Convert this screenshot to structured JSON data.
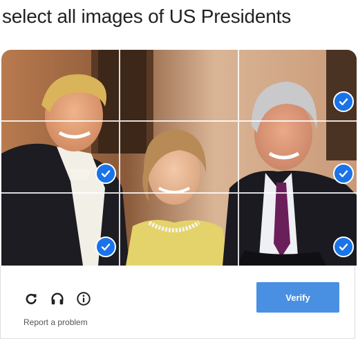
{
  "prompt": "select all images of US Presidents",
  "grid": {
    "tiles": [
      {
        "selected": false
      },
      {
        "selected": false
      },
      {
        "selected": true
      },
      {
        "selected": true
      },
      {
        "selected": false
      },
      {
        "selected": true
      },
      {
        "selected": true
      },
      {
        "selected": false
      },
      {
        "selected": true
      }
    ]
  },
  "icons": [
    "reload-icon",
    "headphones-icon",
    "info-icon"
  ],
  "footer": {
    "verify_label": "Verify",
    "report_label": "Report a problem"
  },
  "colors": {
    "accent": "#4a90e2",
    "check": "#1a73e8"
  }
}
